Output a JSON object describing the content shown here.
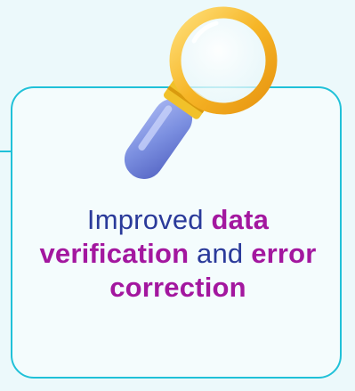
{
  "card": {
    "icon": "magnifying-glass-icon",
    "text": {
      "part1": "Improved ",
      "highlight1": "data verification",
      "part2": " and ",
      "highlight2": "error correction"
    }
  },
  "colors": {
    "background": "#ecf9fb",
    "card_fill": "#f4fcfd",
    "card_border": "#20c1d8",
    "text_primary": "#2a3a9a",
    "text_highlight": "#a3179f",
    "lens_rim": "#f6b526",
    "handle": "#7b8fe0"
  }
}
